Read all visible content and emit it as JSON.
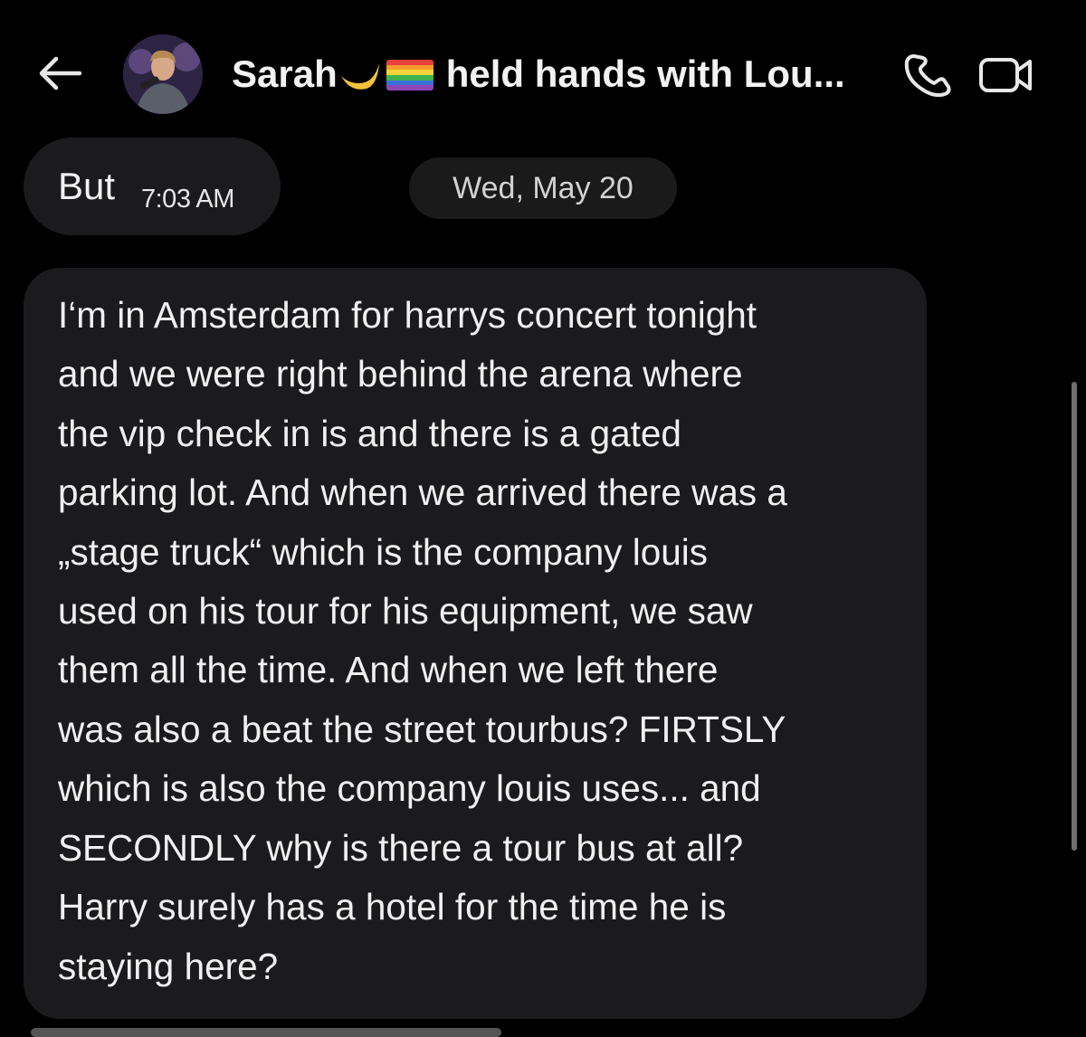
{
  "header": {
    "title_name": "Sarah",
    "title_rest": "held hands with Lou...",
    "back_icon": "arrow-left-icon",
    "call_icon": "phone-icon",
    "video_icon": "video-camera-icon"
  },
  "messages": {
    "first": {
      "text": "But",
      "time": "7:03 AM"
    },
    "date_separator": "Wed, May 20",
    "second": {
      "lines": [
        "I‘m in Amsterdam for harrys concert tonight",
        "and we were right behind the arena where",
        "the vip check in is and there is a gated",
        "parking lot. And when we arrived there was a",
        "„stage truck“ which is the company louis",
        "used on his tour for his equipment, we saw",
        "them all the time. And when we left there",
        "was also a beat the street tourbus? FIRTSLY",
        "which is also the company louis uses... and",
        "SECONDLY why is there a tour bus at all?",
        "Harry surely has a hotel for the time he is",
        "staying here?"
      ]
    }
  },
  "colors": {
    "background": "#000000",
    "bubble": "#1b1b1d",
    "date_pill": "#1a1a1a",
    "text": "#f0f0f0"
  }
}
